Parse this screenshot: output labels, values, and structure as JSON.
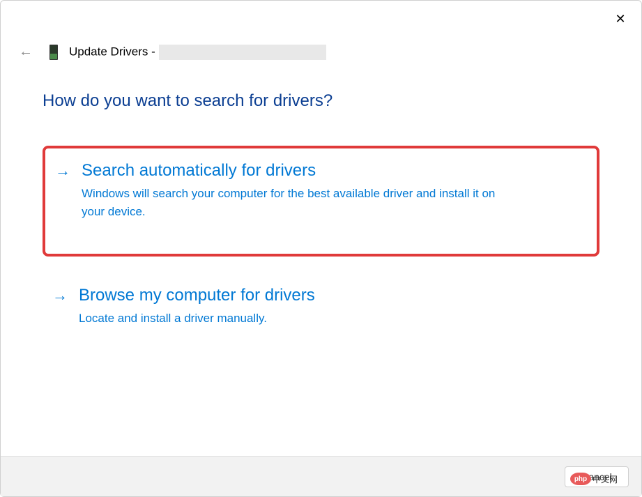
{
  "window": {
    "close_label": "✕"
  },
  "header": {
    "back_arrow": "←",
    "title_prefix": "Update Drivers -"
  },
  "main": {
    "heading": "How do you want to search for drivers?",
    "options": [
      {
        "arrow": "→",
        "title": "Search automatically for drivers",
        "description": "Windows will search your computer for the best available driver and install it on your device."
      },
      {
        "arrow": "→",
        "title": "Browse my computer for drivers",
        "description": "Locate and install a driver manually."
      }
    ]
  },
  "footer": {
    "cancel_label": "Cancel"
  },
  "watermark": {
    "logo_text": "php",
    "suffix": "中文网"
  }
}
